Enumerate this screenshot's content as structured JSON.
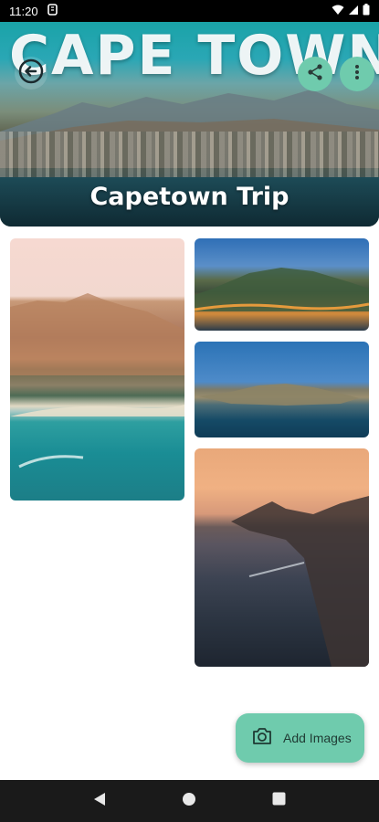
{
  "status_bar": {
    "time": "11:20",
    "icons": [
      "notification-icon",
      "wifi-icon",
      "signal-icon",
      "battery-icon"
    ]
  },
  "header": {
    "hero_text": "CAPE TOWN",
    "title": "Capetown Trip",
    "buttons": {
      "back": "back-arrow-icon",
      "share": "share-icon",
      "more": "more-vert-icon"
    }
  },
  "gallery": {
    "photos": [
      {
        "name": "beach-mountains-photo"
      },
      {
        "name": "table-mountain-aerial-photo"
      },
      {
        "name": "city-bay-photo"
      },
      {
        "name": "coastline-sunset-photo"
      }
    ]
  },
  "fab": {
    "label": "Add Images",
    "icon": "camera-icon"
  },
  "nav": {
    "back": "nav-back-icon",
    "home": "nav-home-icon",
    "recents": "nav-recents-icon"
  },
  "colors": {
    "accent": "#6fcbad",
    "nav_bar": "#1a1a1a",
    "status_bar": "#000000"
  }
}
